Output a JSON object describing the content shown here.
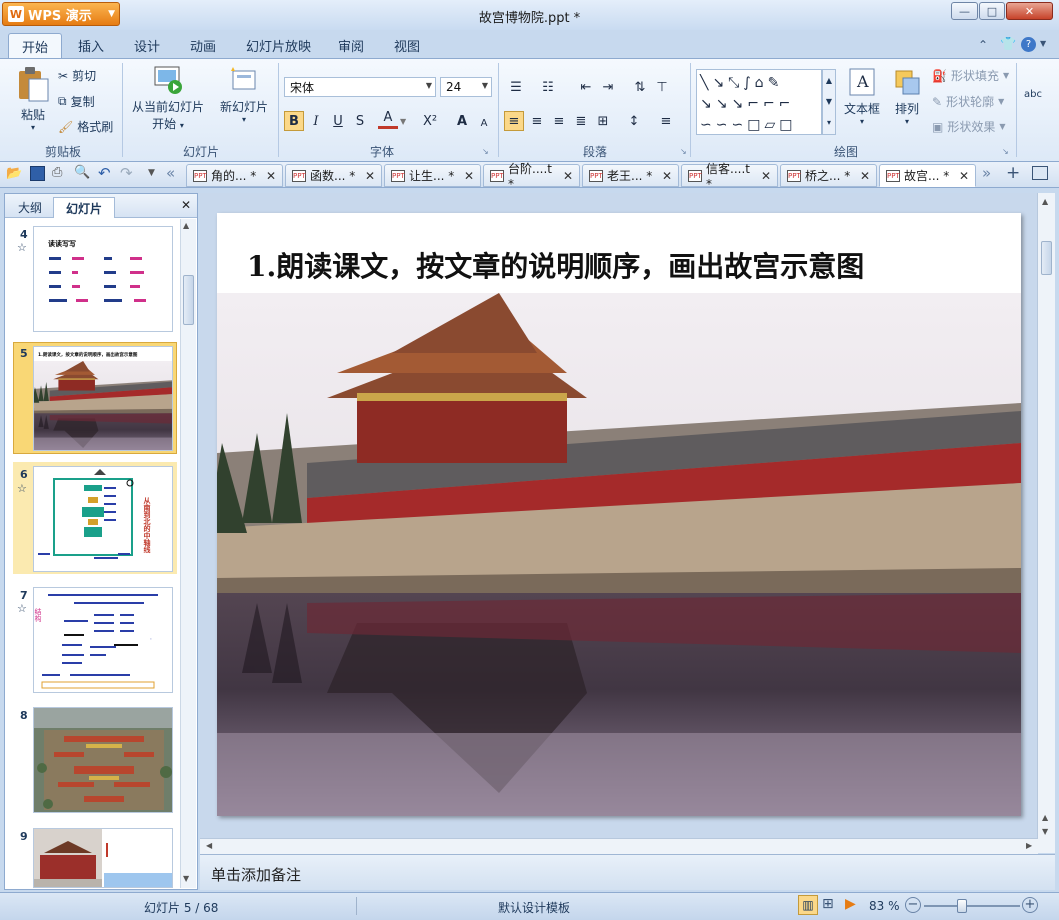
{
  "app": {
    "button_label": "WPS 演示",
    "logo_letter": "W",
    "document_title": "故宫博物院.ppt *"
  },
  "window_controls": {
    "minimize": "—",
    "maximize": "□",
    "close": "✕"
  },
  "ribbon_tabs": [
    "开始",
    "插入",
    "设计",
    "动画",
    "幻灯片放映",
    "审阅",
    "视图"
  ],
  "ribbon": {
    "clipboard": {
      "paste": "粘贴",
      "cut": "剪切",
      "copy": "复制",
      "format_painter": "格式刷",
      "label": "剪贴板"
    },
    "slides": {
      "from_current": "从当前幻灯片",
      "from_current_line2": "开始",
      "new_slide": "新幻灯片",
      "label": "幻灯片"
    },
    "font": {
      "font_name": "宋体",
      "font_size": "24",
      "bold": "B",
      "italic": "I",
      "underline": "U",
      "shadow": "S",
      "color": "A",
      "superscript": "X²",
      "grow": "A",
      "shrink": "A",
      "label": "字体"
    },
    "paragraph": {
      "label": "段落"
    },
    "drawing": {
      "textbox": "文本框",
      "arrange": "排列",
      "shape_fill": "形状填充",
      "shape_outline": "形状轮廓",
      "shape_effect": "形状效果",
      "label": "绘图",
      "text_ab": "abc"
    }
  },
  "document_tabs": [
    {
      "label": "角的... *",
      "active": false
    },
    {
      "label": "函数... *",
      "active": false
    },
    {
      "label": "让生... *",
      "active": false
    },
    {
      "label": "台阶....t *",
      "active": false
    },
    {
      "label": "老王... *",
      "active": false
    },
    {
      "label": "信客....t *",
      "active": false
    },
    {
      "label": "桥之... *",
      "active": false
    },
    {
      "label": "故宫... *",
      "active": true
    }
  ],
  "left_pane": {
    "tabs": [
      "大纲",
      "幻灯片"
    ],
    "close": "✕",
    "thumbnails": [
      {
        "num": "4",
        "star": "☆",
        "title": "读读写写"
      },
      {
        "num": "5",
        "star": "",
        "title": "1.朗读课文，按文章的说明顺序，画出故宫示意图"
      },
      {
        "num": "6",
        "star": "☆",
        "title": "从南到北的中轴线"
      },
      {
        "num": "7",
        "star": "☆",
        "title": "结构"
      },
      {
        "num": "8",
        "star": "",
        "title": ""
      },
      {
        "num": "9",
        "star": "",
        "title": ""
      }
    ]
  },
  "slide": {
    "title": "1.朗读课文，按文章的说明顺序，画出故宫示意图"
  },
  "notes": {
    "placeholder": "单击添加备注"
  },
  "status": {
    "slide_info": "幻灯片 5 / 68",
    "template": "默认设计模板",
    "zoom": "83 %"
  },
  "colors": {
    "accent": "#e67c14",
    "ribbon_bg": "#dde9f7",
    "wall_red": "#b52a2a",
    "sky": "#ece6ee",
    "water": "#2c2430"
  }
}
